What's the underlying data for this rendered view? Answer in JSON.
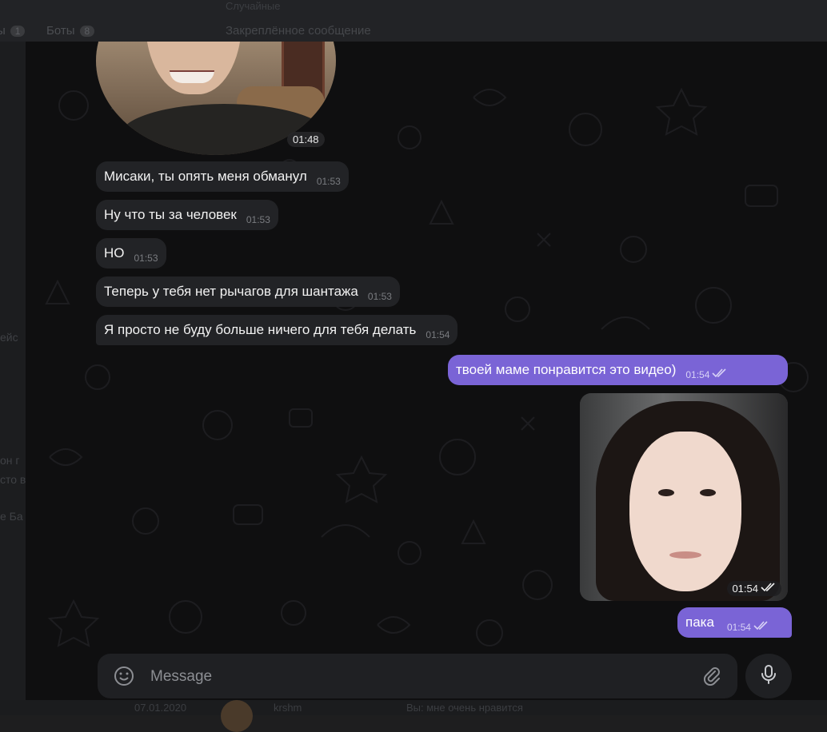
{
  "background_app": {
    "folders": [
      {
        "label": "Боты",
        "count": "8"
      }
    ],
    "folder_count_left": "1",
    "top_small_text": "Случайные",
    "pinned_label": "Закреплённое сообщение",
    "side_fragments": [
      "ейс",
      "он г",
      "сто в",
      "е Ба"
    ],
    "bottom_date": "07.01.2020",
    "bottom_name": "krshm",
    "bottom_preview": "Вы: мне очень нравится"
  },
  "chat": {
    "round_video": {
      "time": "01:48"
    },
    "incoming": [
      {
        "text": "Мисаки, ты опять меня обманул",
        "time": "01:53"
      },
      {
        "text": "Ну что ты за человек",
        "time": "01:53"
      },
      {
        "text": "НО",
        "time": "01:53"
      },
      {
        "text": "Теперь у тебя нет рычагов для шантажа",
        "time": "01:53"
      },
      {
        "text": "Я просто не буду больше ничего для тебя делать",
        "time": "01:54"
      }
    ],
    "outgoing_text_1": {
      "text": "твоей маме понравится это видео)",
      "time": "01:54"
    },
    "photo": {
      "time": "01:54"
    },
    "outgoing_text_2": {
      "text": "пака",
      "time": "01:54"
    }
  },
  "composer": {
    "placeholder": "Message"
  },
  "icons": {
    "emoji": "smile-icon",
    "attach": "paperclip-icon",
    "mic": "microphone-icon",
    "read": "double-check-icon"
  },
  "colors": {
    "outgoing_bubble": "#7a64d6",
    "incoming_bubble": "#222326",
    "chat_background": "#0f0f10"
  }
}
